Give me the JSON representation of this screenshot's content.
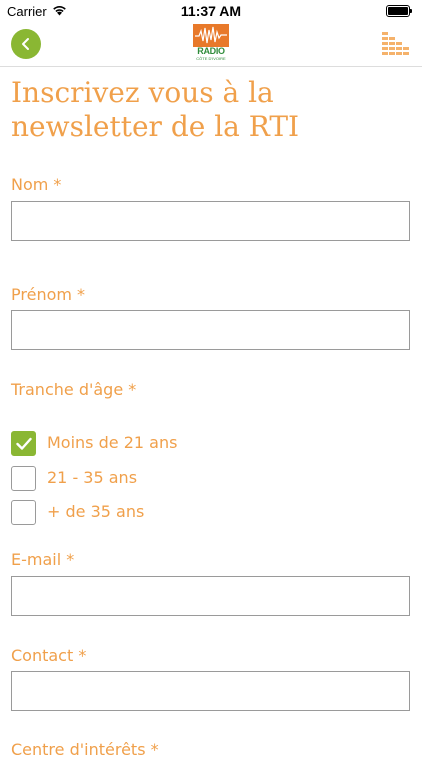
{
  "status_bar": {
    "carrier": "Carrier",
    "time": "11:37 AM"
  },
  "nav": {
    "logo_text": "RADIO",
    "logo_subtext": "CÔTE D'IVOIRE",
    "accent_color": "#8ab733"
  },
  "page": {
    "title": "Inscrivez vous à la newsletter de la RTI",
    "text_color": "#f0a04b"
  },
  "form": {
    "nom_label": "Nom *",
    "nom_value": "",
    "prenom_label": "Prénom *",
    "prenom_value": "",
    "age_label": "Tranche d'âge *",
    "age_options": [
      {
        "label": "Moins de 21 ans",
        "checked": true
      },
      {
        "label": "21 - 35 ans",
        "checked": false
      },
      {
        "label": "+ de 35 ans",
        "checked": false
      }
    ],
    "email_label": "E-mail *",
    "email_value": "",
    "contact_label": "Contact *",
    "contact_value": "",
    "interests_label": "Centre d'intérêts *"
  }
}
